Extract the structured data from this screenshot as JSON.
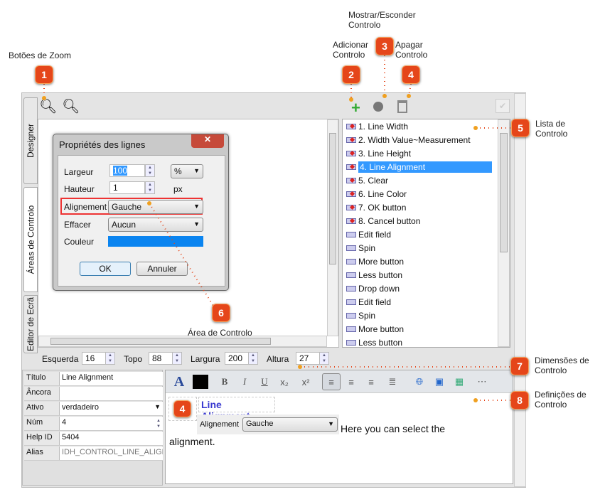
{
  "annotations": {
    "zoom_buttons": "Botões de Zoom",
    "add_control": "Adicionar Controlo",
    "show_hide_control": "Mostrar/Esconder Controlo",
    "delete_control": "Apagar Controlo",
    "control_list": "Lista de Controlo",
    "control_area": "Área de Controlo",
    "control_dimensions": "Dimensões de Controlo",
    "control_settings": "Definições de Controlo"
  },
  "callouts": [
    "1",
    "2",
    "3",
    "4",
    "5",
    "6",
    "7",
    "8"
  ],
  "callout_color": "#e5461a",
  "tabs": [
    "Designer",
    "Áreas de Controlo",
    "Editor de Ecrã"
  ],
  "dialog": {
    "title": "Propriétés des lignes",
    "rows": {
      "largeur": "Largeur",
      "largeur_value": "100",
      "largeur_unit": "%",
      "hauteur": "Hauteur",
      "hauteur_value": "1",
      "hauteur_unit": "px",
      "alignement": "Alignement",
      "alignement_value": "Gauche",
      "effacer": "Effacer",
      "effacer_value": "Aucun",
      "couleur": "Couleur"
    },
    "color_value": "#0a84f0",
    "ok": "OK",
    "cancel": "Annuler"
  },
  "list": [
    {
      "label": "1. Line Width",
      "marked": true
    },
    {
      "label": "2. Width Value~Measurement",
      "marked": true
    },
    {
      "label": "3. Line Height",
      "marked": true
    },
    {
      "label": "4. Line Alignment",
      "marked": true,
      "selected": true
    },
    {
      "label": "5. Clear",
      "marked": true
    },
    {
      "label": "6. Line Color",
      "marked": true
    },
    {
      "label": "7. OK button",
      "marked": true
    },
    {
      "label": "8. Cancel button",
      "marked": true
    },
    {
      "label": "Edit field"
    },
    {
      "label": "Spin"
    },
    {
      "label": "More button"
    },
    {
      "label": "Less button"
    },
    {
      "label": "Drop down"
    },
    {
      "label": "Edit field"
    },
    {
      "label": "Spin"
    },
    {
      "label": "More button"
    },
    {
      "label": "Less button"
    }
  ],
  "dimensions": {
    "left_label": "Esquerda",
    "left": "16",
    "top_label": "Topo",
    "top": "88",
    "width_label": "Largura",
    "width": "200",
    "height_label": "Altura",
    "height": "27"
  },
  "properties": [
    {
      "label": "Título",
      "value": "Line Alignment"
    },
    {
      "label": "Âncora",
      "value": ""
    },
    {
      "label": "Ativo",
      "value": "verdadeiro"
    },
    {
      "label": "Núm",
      "value": "4"
    },
    {
      "label": "Help ID",
      "value": "5404"
    },
    {
      "label": "Alias",
      "value": "IDH_CONTROL_LINE_ALIGNM"
    }
  ],
  "editor": {
    "heading": "Line Alignment",
    "callout": "4",
    "field_label": "Alignement",
    "field_value": "Gauche",
    "text_line1": "Here you can select the",
    "text_line2": "alignment."
  }
}
